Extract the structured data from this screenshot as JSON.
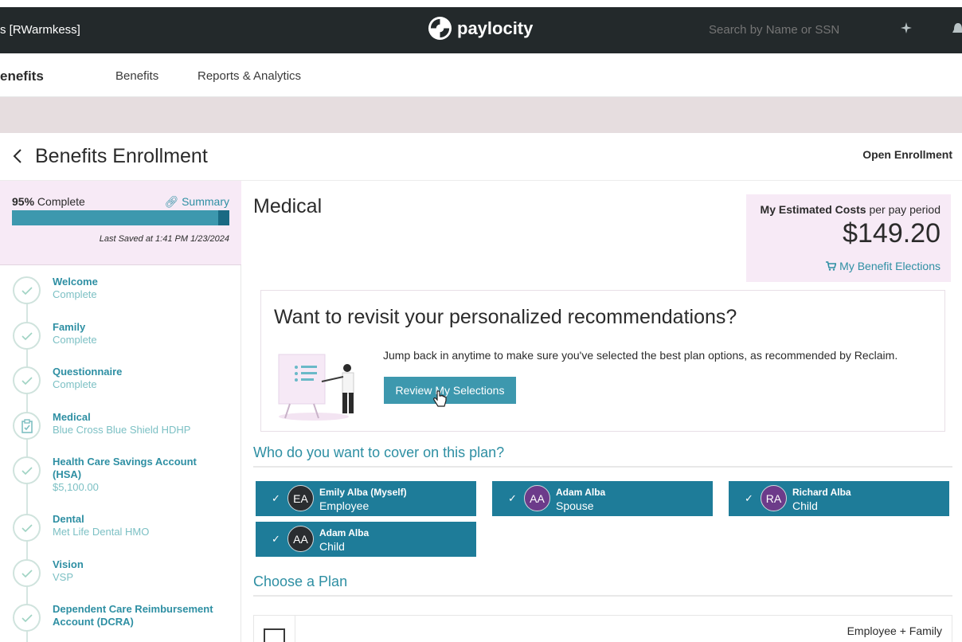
{
  "topbar": {
    "user_context": "s [RWarmkess]",
    "logo_text": "paylocity",
    "search_placeholder": "Search by Name or SSN"
  },
  "nav": {
    "brand": "enefits",
    "items": [
      "Benefits",
      "Reports & Analytics"
    ]
  },
  "header": {
    "title": "Benefits Enrollment",
    "enrollment_type": "Open Enrollment"
  },
  "progress": {
    "percent_label": "95%",
    "complete_label": "Complete",
    "percent_value": 95,
    "summary_label": "Summary",
    "last_saved": "Last Saved at 1:41 PM 1/23/2024"
  },
  "steps": [
    {
      "title": "Welcome",
      "sub": "Complete",
      "status": "complete"
    },
    {
      "title": "Family",
      "sub": "Complete",
      "status": "complete"
    },
    {
      "title": "Questionnaire",
      "sub": "Complete",
      "status": "complete"
    },
    {
      "title": "Medical",
      "sub": "Blue Cross Blue Shield HDHP",
      "status": "current"
    },
    {
      "title": "Health Care Savings Account (HSA)",
      "sub": "$5,100.00",
      "status": "complete"
    },
    {
      "title": "Dental",
      "sub": "Met Life Dental HMO",
      "status": "complete"
    },
    {
      "title": "Vision",
      "sub": "VSP",
      "status": "complete"
    },
    {
      "title": "Dependent Care Reimbursement Account (DCRA)",
      "sub": "",
      "status": "complete"
    }
  ],
  "main": {
    "section_title": "Medical",
    "cost": {
      "label_bold": "My Estimated Costs",
      "label_rest": " per pay period",
      "value": "$149.20",
      "elections_link": "My Benefit Elections"
    },
    "recommendation": {
      "title": "Want to revisit your personalized recommendations?",
      "text": "Jump back in anytime to make sure you've selected the best plan options, as recommended by Reclaim.",
      "button": "Review My Selections"
    },
    "cover_title": "Who do you want to cover on this plan?",
    "members": [
      {
        "initials": "EA",
        "name": "Emily Alba (Myself)",
        "role": "Employee",
        "checked": true
      },
      {
        "initials": "AA",
        "name": "Adam Alba",
        "role": "Spouse",
        "checked": true
      },
      {
        "initials": "RA",
        "name": "Richard Alba",
        "role": "Child",
        "checked": true
      },
      {
        "initials": "AA",
        "name": "Adam Alba",
        "role": "Child",
        "checked": true
      }
    ],
    "plan_title": "Choose a Plan",
    "plan_tier": "Employee + Family"
  },
  "colors": {
    "accent": "#2e8fa3",
    "member_card": "#1e7c99",
    "highlight": "#f7eaf6",
    "topbar": "#23292b"
  }
}
